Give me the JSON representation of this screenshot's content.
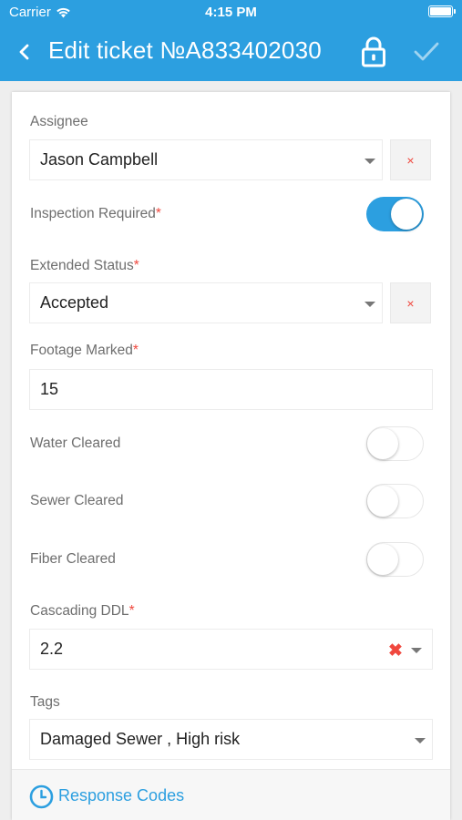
{
  "status_bar": {
    "carrier": "Carrier",
    "time": "4:15 PM"
  },
  "header": {
    "title": "Edit ticket №A833402030"
  },
  "colors": {
    "accent": "#2c9fe0",
    "required": "#f0483e"
  },
  "form": {
    "assignee": {
      "label": "Assignee",
      "value": "Jason Campbell",
      "clear": "×"
    },
    "inspection_required": {
      "label": "Inspection Required",
      "required_mark": "*",
      "on": true
    },
    "extended_status": {
      "label": "Extended Status",
      "required_mark": "*",
      "value": "Accepted",
      "clear": "×"
    },
    "footage_marked": {
      "label": "Footage Marked",
      "required_mark": "*",
      "value": "15"
    },
    "water_cleared": {
      "label": "Water Cleared",
      "on": false
    },
    "sewer_cleared": {
      "label": "Sewer Cleared",
      "on": false
    },
    "fiber_cleared": {
      "label": "Fiber Cleared",
      "on": false
    },
    "cascading_ddl": {
      "label": "Cascading DDL",
      "required_mark": "*",
      "value": "2.2",
      "clear": "✖"
    },
    "tags": {
      "label": "Tags",
      "value": "Damaged Sewer , High risk"
    }
  },
  "footer": {
    "link": "Response Codes",
    "icon": "clock-icon"
  }
}
